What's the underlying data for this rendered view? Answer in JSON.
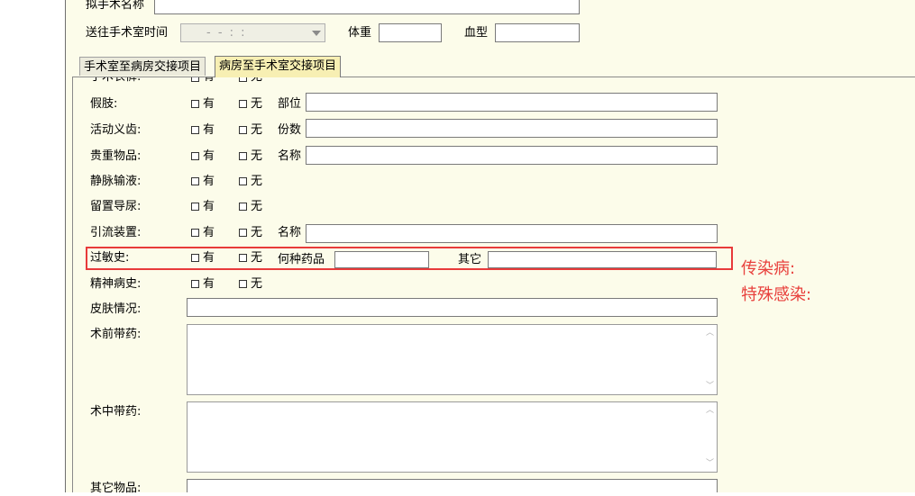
{
  "header": {
    "surgery_name_label": "拟手术名称",
    "send_time_label": "送往手术室时间",
    "send_time_placeholder": "- -   : :",
    "weight_label": "体重",
    "blood_type_label": "血型"
  },
  "tabs": [
    {
      "label": "手术室至病房交接项目",
      "active": false
    },
    {
      "label": "病房至手术室交接项目",
      "active": true
    }
  ],
  "options": {
    "yes": "有",
    "no": "无"
  },
  "rows": {
    "surgery_clothes": {
      "label": "手术衣裤:"
    },
    "prosthesis": {
      "label": "假肢:",
      "extra_label": "部位"
    },
    "dentures": {
      "label": "活动义齿:",
      "extra_label": "份数"
    },
    "valuables": {
      "label": "贵重物品:",
      "extra_label": "名称"
    },
    "iv_infusion": {
      "label": "静脉输液:"
    },
    "catheter": {
      "label": "留置导尿:"
    },
    "drainage": {
      "label": "引流装置:",
      "extra_label": "名称"
    },
    "allergy": {
      "label": "过敏史:",
      "extra_label": "何种药品",
      "other_label": "其它"
    },
    "mental_history": {
      "label": "精神病史:"
    },
    "skin": {
      "label": "皮肤情况:"
    },
    "preop_meds": {
      "label": "术前带药:"
    },
    "intraop_meds": {
      "label": "术中带药:"
    },
    "other_items": {
      "label": "其它物品:"
    }
  },
  "annotations": {
    "infectious": "传染病:",
    "special_infection": "特殊感染:"
  },
  "colors": {
    "panel_bg": "#fcfcea",
    "annotation": "#e8403c",
    "active_tab": "#f7efb3"
  }
}
